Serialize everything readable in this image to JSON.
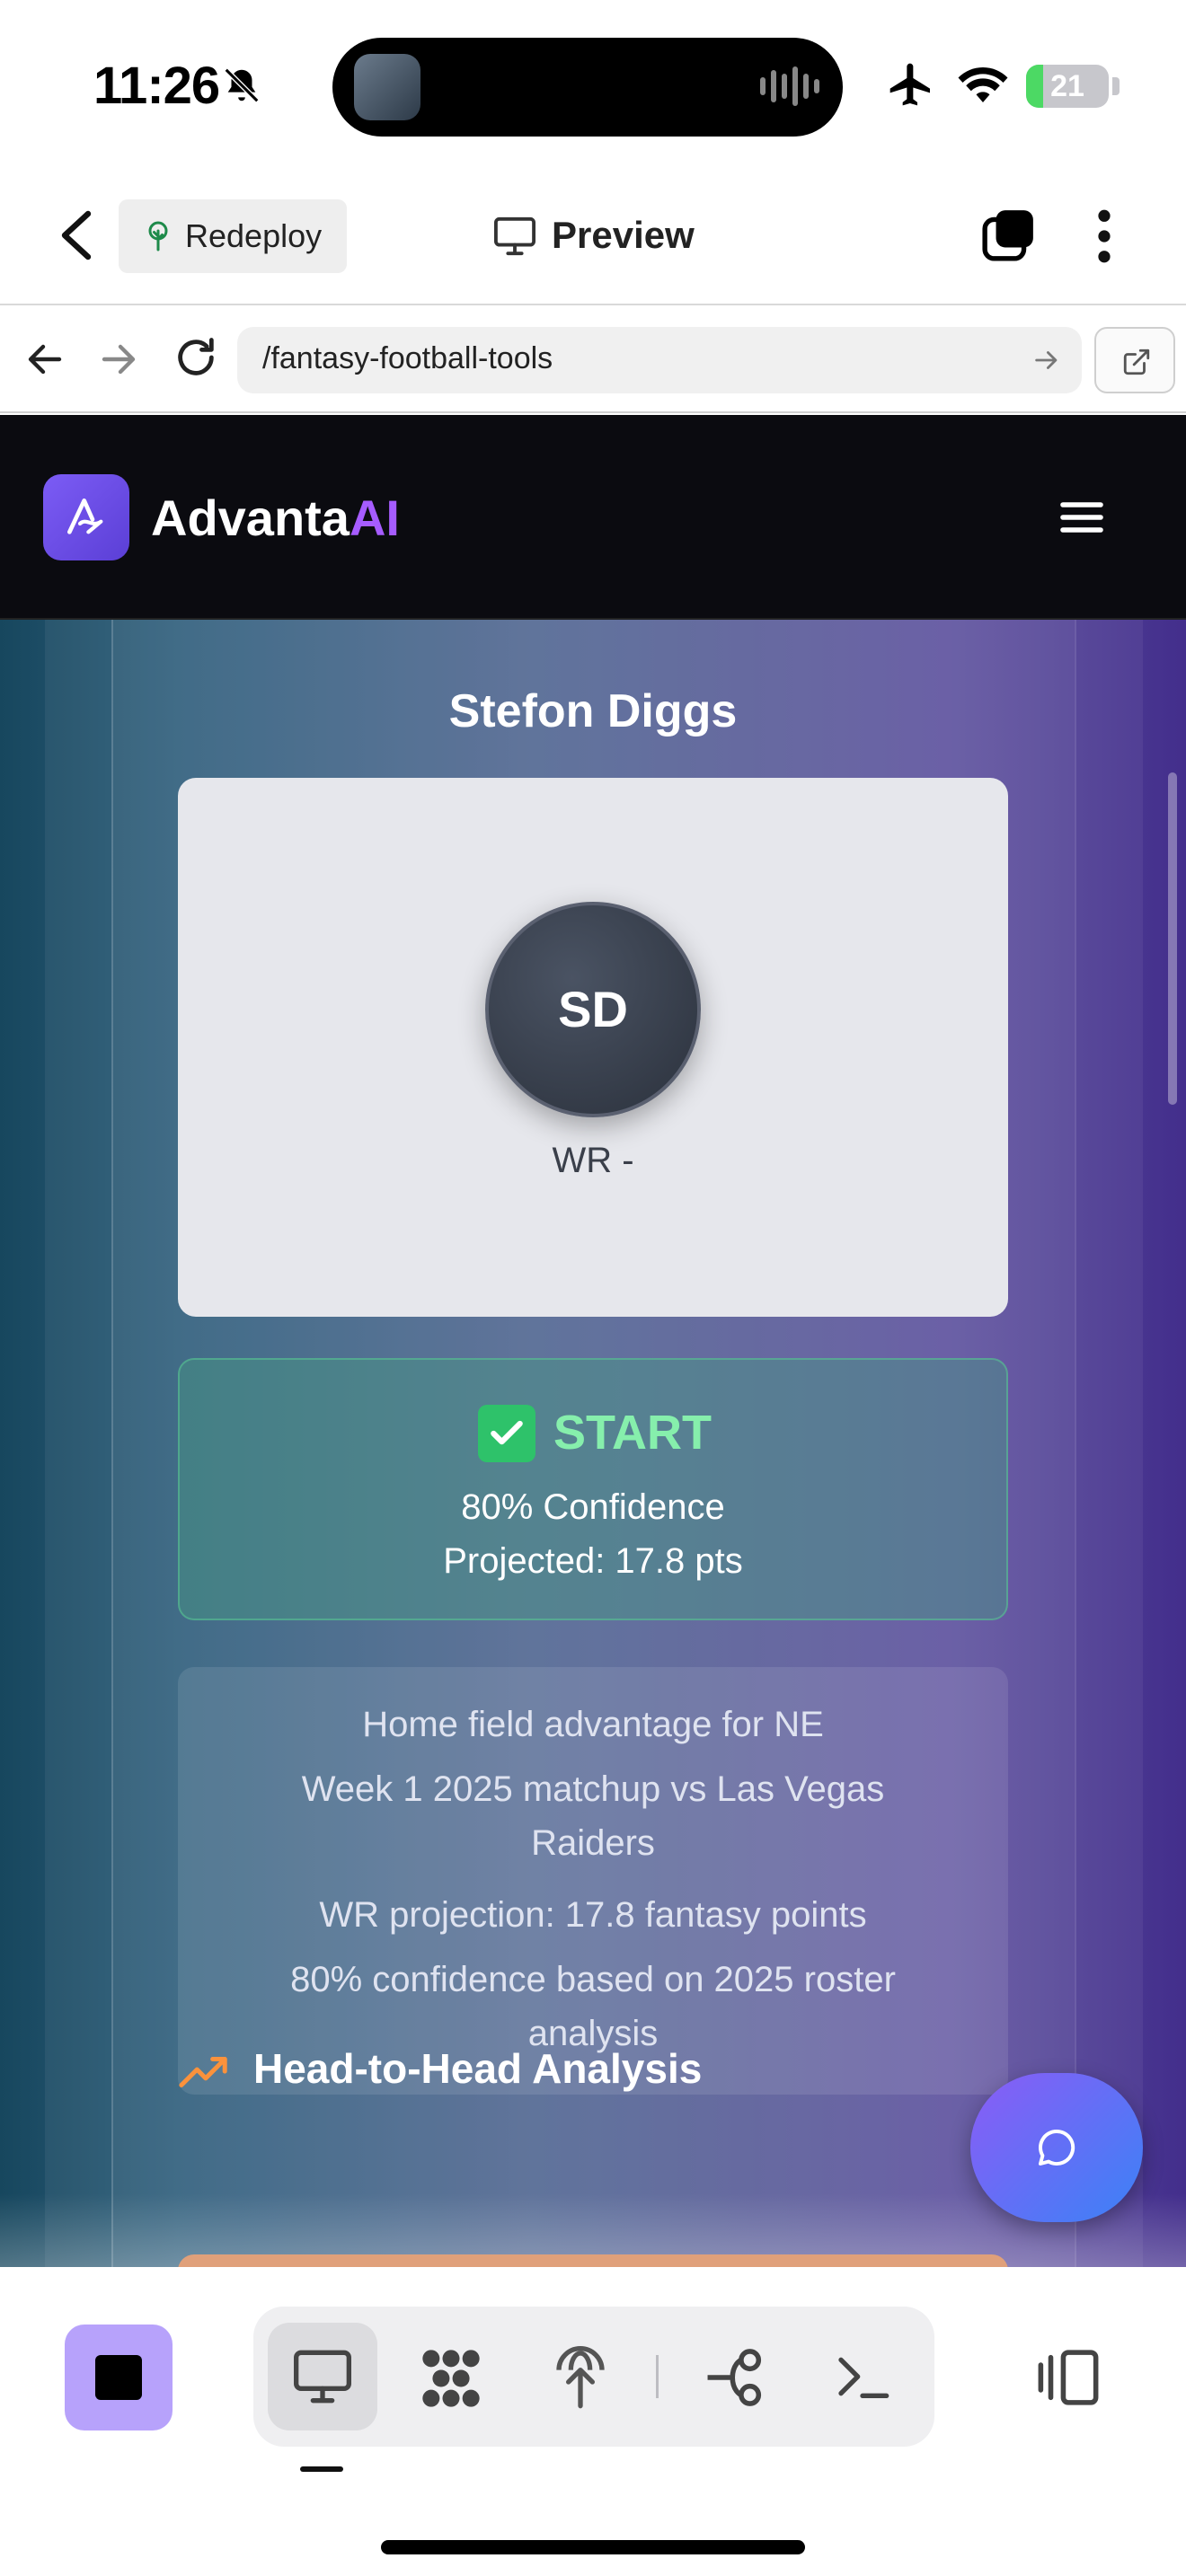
{
  "status_bar": {
    "time": "11:26",
    "battery": "21",
    "battery_level": 0.21
  },
  "app_header": {
    "redeploy_label": "Redeploy",
    "preview_label": "Preview"
  },
  "url_bar": {
    "url": "/fantasy-football-tools"
  },
  "site": {
    "logo_main": "Advanta",
    "logo_accent": "AI"
  },
  "player": {
    "name": "Stefon Diggs",
    "initials": "SD",
    "position": "WR -",
    "verdict": "START",
    "confidence": "80% Confidence",
    "projected": "Projected: 17.8 pts",
    "reasons": [
      "Home field advantage for NE",
      "Week 1 2025 matchup vs Las Vegas Raiders",
      "WR projection: 17.8 fantasy points",
      "80% confidence based on 2025 roster analysis"
    ]
  },
  "section": {
    "head_to_head_title": "Head-to-Head Analysis"
  },
  "colors": {
    "accent": "#a65cff",
    "start_green": "#86efac",
    "stop_button": "#b7a2fb"
  }
}
